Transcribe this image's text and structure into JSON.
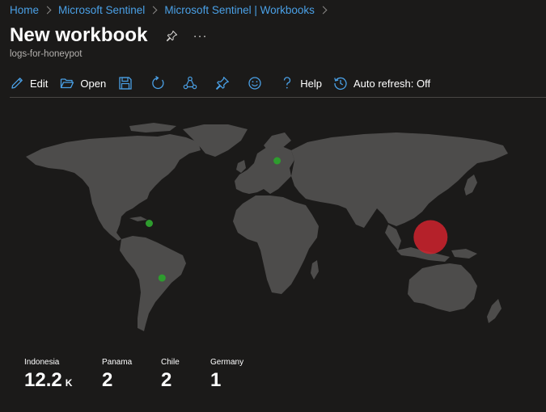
{
  "breadcrumb": [
    "Home",
    "Microsoft Sentinel",
    "Microsoft Sentinel | Workbooks"
  ],
  "header": {
    "title": "New workbook",
    "subtitle": "logs-for-honeypot",
    "more": "···"
  },
  "toolbar": {
    "edit": "Edit",
    "open": "Open",
    "help": "Help",
    "auto_refresh": "Auto refresh: Off"
  },
  "map": {
    "land_color": "#4d4c4b",
    "points": [
      {
        "country": "Indonesia",
        "value": 12200,
        "color": "#d0232e",
        "lon": 118,
        "lat": -2
      },
      {
        "country": "Panama",
        "value": 2,
        "color": "#2e9c2e",
        "lon": -80,
        "lat": 9
      },
      {
        "country": "Chile",
        "value": 2,
        "color": "#2e9c2e",
        "lon": -71,
        "lat": -33
      },
      {
        "country": "Germany",
        "value": 1,
        "color": "#2e9c2e",
        "lon": 10,
        "lat": 51
      }
    ]
  },
  "legend": [
    {
      "label": "Indonesia",
      "value": "12.2",
      "unit": "K"
    },
    {
      "label": "Panama",
      "value": "2",
      "unit": ""
    },
    {
      "label": "Chile",
      "value": "2",
      "unit": ""
    },
    {
      "label": "Germany",
      "value": "1",
      "unit": ""
    }
  ]
}
